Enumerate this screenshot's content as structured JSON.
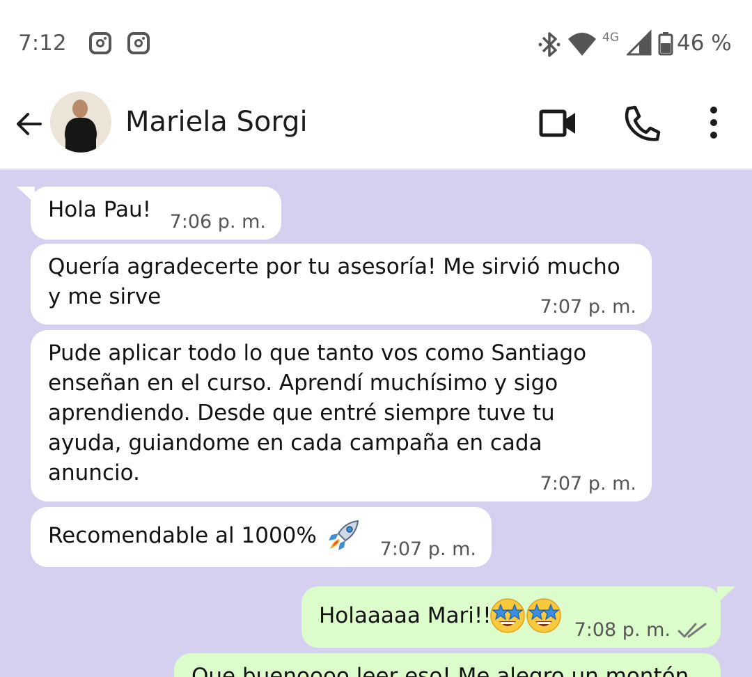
{
  "status_bar": {
    "time": "7:12",
    "network_label": "4G",
    "battery": "46 %",
    "icons": [
      "instagram-icon",
      "instagram-icon",
      "bluetooth-icon",
      "wifi-icon",
      "signal-icon",
      "battery-icon"
    ]
  },
  "header": {
    "contact_name": "Mariela Sorgi",
    "actions": [
      "back-arrow-icon",
      "video-call-icon",
      "phone-icon",
      "more-vert-icon"
    ]
  },
  "colors": {
    "chat_background": "#d6d0f0",
    "incoming_bubble": "#ffffff",
    "outgoing_bubble": "#dcfccb"
  },
  "messages": [
    {
      "direction": "incoming",
      "text": "Hola Pau!",
      "time": "7:06 p. m."
    },
    {
      "direction": "incoming",
      "text": "Quería agradecerte por tu asesoría! Me sirvió mucho\ny me sirve",
      "time": "7:07 p. m."
    },
    {
      "direction": "incoming",
      "text": "Pude aplicar todo lo que tanto vos como Santiago\nenseñan en el curso. Aprendí muchísimo y sigo\naprendiendo. Desde que entré siempre tuve tu\nayuda, guiandome en cada campaña en cada\nanuncio.",
      "time": "7:07 p. m."
    },
    {
      "direction": "incoming",
      "text": "Recomendable al 1000%",
      "emoji": "rocket",
      "time": "7:07 p. m."
    },
    {
      "direction": "outgoing",
      "text": "Holaaaaa Mari!!",
      "emoji": "star-struck x2",
      "time": "7:08 p. m.",
      "status": "read"
    },
    {
      "direction": "outgoing",
      "text": "Que buenoooo leer eso! Me alegro un montón"
    }
  ]
}
